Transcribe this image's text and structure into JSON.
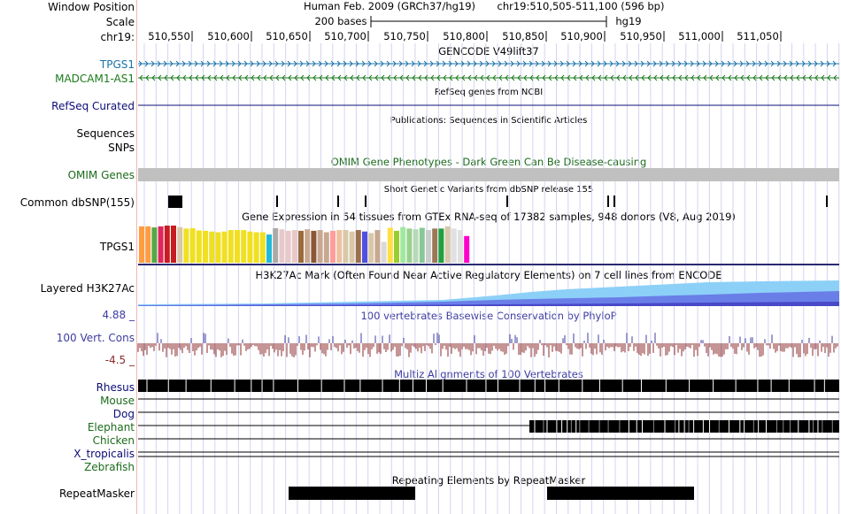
{
  "header": {
    "window_position_label": "Window Position",
    "scale_label": "Scale",
    "chrom_label": "chr19:",
    "assembly_text": "Human Feb. 2009 (GRCh37/hg19)",
    "position_text": "chr19:510,505-511,100 (596 bp)",
    "scale_text": "200 bases",
    "db_text": "hg19",
    "ticks": [
      "510,550",
      "510,600",
      "510,650",
      "510,700",
      "510,750",
      "510,800",
      "510,850",
      "510,900",
      "510,950",
      "511,000",
      "511,050"
    ]
  },
  "tracks": {
    "gencode": {
      "title": "GENCODE V49lift37",
      "items": [
        "TPGS1",
        "MADCAM1-AS1"
      ],
      "colors": [
        "#1a73a8",
        "#1b7a1b"
      ]
    },
    "refseq": {
      "title": "RefSeq genes from NCBI",
      "label": "RefSeq Curated",
      "color": "#0c0c78"
    },
    "publications": {
      "title": "Publications: Sequences in Scientific Articles",
      "labels": [
        "Sequences",
        "SNPs"
      ]
    },
    "omim": {
      "title": "OMIM Gene Phenotypes - Dark Green Can Be Disease-causing",
      "label": "OMIM Genes",
      "color": "#1b6b1b"
    },
    "dbsnp": {
      "title": "Short Genetic Variants from dbSNP release 155",
      "label": "Common dbSNP(155)"
    },
    "gtex": {
      "title": "Gene Expression in 54 tissues from GTEx RNA-seq of 17382 samples, 948 donors (V8, Aug 2019)",
      "label": "TPGS1",
      "values": [
        0.98,
        0.98,
        0.95,
        0.98,
        1.0,
        1.0,
        0.96,
        0.92,
        0.93,
        0.87,
        0.86,
        0.84,
        0.82,
        0.84,
        0.88,
        0.88,
        0.88,
        0.84,
        0.82,
        0.82,
        0.76,
        0.93,
        0.9,
        0.86,
        0.88,
        0.86,
        0.9,
        0.86,
        0.88,
        0.82,
        0.86,
        0.88,
        0.88,
        0.84,
        0.88,
        0.84,
        0.8,
        0.88,
        0.56,
        0.94,
        0.86,
        0.96,
        0.92,
        0.9,
        0.94,
        0.88,
        0.92,
        0.92,
        0.98,
        0.92,
        0.88,
        0.72
      ],
      "colors": [
        "#ff9d40",
        "#ff9d40",
        "#55a845",
        "#e0245c",
        "#c81c20",
        "#c81c20",
        "#d8c8a8",
        "#f0e020",
        "#f0e020",
        "#f0e020",
        "#f0e020",
        "#f0e020",
        "#f0e020",
        "#f0e020",
        "#f0e020",
        "#f0e020",
        "#f0e020",
        "#f0e020",
        "#f0e020",
        "#f0e020",
        "#22b8d8",
        "#aaaaaa",
        "#e8c8c8",
        "#e8c8c8",
        "#e8c8c8",
        "#9a6b3c",
        "#c8a890",
        "#8a5838",
        "#c8a890",
        "#c8a890",
        "#ff9d9d",
        "#f0c0a0",
        "#d8c8a8",
        "#d8c8a8",
        "#9a7050",
        "#5050e0",
        "#d8c8a8",
        "#c8a890",
        "#ccccccc0",
        "#ffe040",
        "#9acd32",
        "#a0e8a0",
        "#9ad090",
        "#b8d8b8",
        "#88c898",
        "#cccccc",
        "#9a7858",
        "#20a040",
        "#d8c8a8",
        "#e0e0e0",
        "#e0e0e0",
        "#ff00cc"
      ]
    },
    "h3k27ac": {
      "title": "H3K27Ac Mark (Often Found Near Active Regulatory Elements) on 7 cell lines from ENCODE",
      "label": "Layered H3K27Ac"
    },
    "phylop": {
      "title": "100 vertebrates Basewise Conservation by PhyloP",
      "label": "100 Vert. Cons",
      "max_label": "4.88 _",
      "min_label": "-4.5 _"
    },
    "multiz": {
      "title": "Multiz Alignments of 100 Vertebrates",
      "species": [
        "Rhesus",
        "Mouse",
        "Dog",
        "Elephant",
        "Chicken",
        "X_tropicalis",
        "Zebrafish"
      ]
    },
    "repeatmasker": {
      "title": "Repeating Elements by RepeatMasker",
      "label": "RepeatMasker"
    }
  },
  "colors": {
    "gencode_blue": "#1a73a8",
    "gencode_green": "#1b7a1b",
    "refseq": "#0c0c78",
    "omim": "#1b6b1b",
    "phylop_blue": "#3c3ca0",
    "phylop_red": "#8b2a2a",
    "h3k_light": "#8cd0f8",
    "h3k_mid": "#6a7ee8",
    "h3k_dark": "#4848c8"
  }
}
